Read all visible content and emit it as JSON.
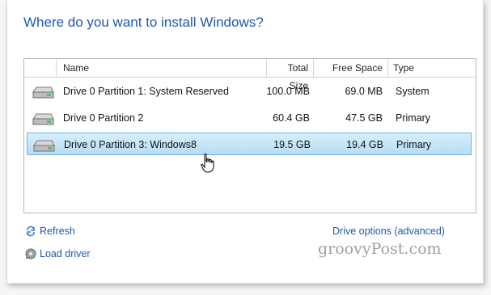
{
  "title": "Where do you want to install Windows?",
  "table": {
    "columns": [
      "Name",
      "Total Size",
      "Free Space",
      "Type"
    ],
    "rows": [
      {
        "name": "Drive 0 Partition 1: System Reserved",
        "total": "100.0 MB",
        "free": "69.0 MB",
        "type": "System"
      },
      {
        "name": "Drive 0 Partition 2",
        "total": "60.4 GB",
        "free": "47.5 GB",
        "type": "Primary"
      },
      {
        "name": "Drive 0 Partition 3: Windows8",
        "total": "19.5 GB",
        "free": "19.4 GB",
        "type": "Primary"
      }
    ],
    "selected_index": 2
  },
  "actions": {
    "refresh": "Refresh",
    "load_driver": "Load driver",
    "drive_options": "Drive options (advanced)"
  },
  "watermark": "groovyPost.com",
  "colors": {
    "accent": "#1d5ab1",
    "selection_fill": "#c6e5f8",
    "selection_border": "#6bb3e8"
  },
  "icons": [
    "drive-icon",
    "refresh-icon",
    "load-driver-icon",
    "hand-cursor-icon"
  ]
}
